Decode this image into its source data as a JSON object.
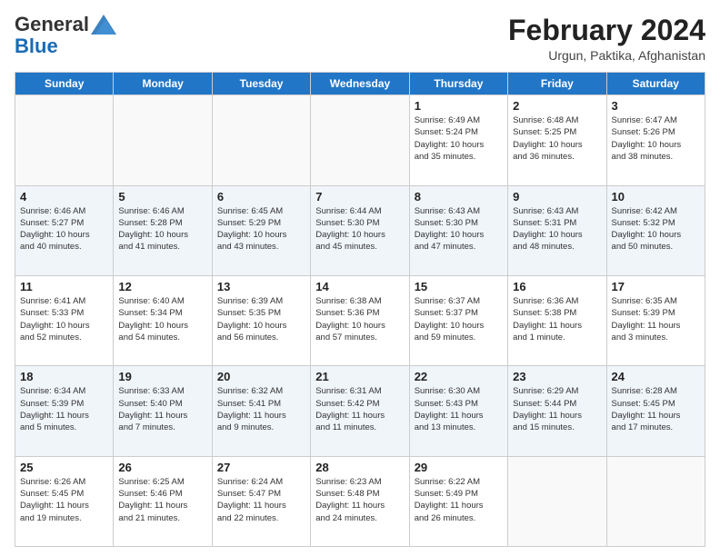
{
  "logo": {
    "general": "General",
    "blue": "Blue"
  },
  "title": "February 2024",
  "location": "Urgun, Paktika, Afghanistan",
  "days_of_week": [
    "Sunday",
    "Monday",
    "Tuesday",
    "Wednesday",
    "Thursday",
    "Friday",
    "Saturday"
  ],
  "weeks": [
    {
      "days": [
        {
          "number": "",
          "info": ""
        },
        {
          "number": "",
          "info": ""
        },
        {
          "number": "",
          "info": ""
        },
        {
          "number": "",
          "info": ""
        },
        {
          "number": "1",
          "info": "Sunrise: 6:49 AM\nSunset: 5:24 PM\nDaylight: 10 hours\nand 35 minutes."
        },
        {
          "number": "2",
          "info": "Sunrise: 6:48 AM\nSunset: 5:25 PM\nDaylight: 10 hours\nand 36 minutes."
        },
        {
          "number": "3",
          "info": "Sunrise: 6:47 AM\nSunset: 5:26 PM\nDaylight: 10 hours\nand 38 minutes."
        }
      ]
    },
    {
      "days": [
        {
          "number": "4",
          "info": "Sunrise: 6:46 AM\nSunset: 5:27 PM\nDaylight: 10 hours\nand 40 minutes."
        },
        {
          "number": "5",
          "info": "Sunrise: 6:46 AM\nSunset: 5:28 PM\nDaylight: 10 hours\nand 41 minutes."
        },
        {
          "number": "6",
          "info": "Sunrise: 6:45 AM\nSunset: 5:29 PM\nDaylight: 10 hours\nand 43 minutes."
        },
        {
          "number": "7",
          "info": "Sunrise: 6:44 AM\nSunset: 5:30 PM\nDaylight: 10 hours\nand 45 minutes."
        },
        {
          "number": "8",
          "info": "Sunrise: 6:43 AM\nSunset: 5:30 PM\nDaylight: 10 hours\nand 47 minutes."
        },
        {
          "number": "9",
          "info": "Sunrise: 6:43 AM\nSunset: 5:31 PM\nDaylight: 10 hours\nand 48 minutes."
        },
        {
          "number": "10",
          "info": "Sunrise: 6:42 AM\nSunset: 5:32 PM\nDaylight: 10 hours\nand 50 minutes."
        }
      ]
    },
    {
      "days": [
        {
          "number": "11",
          "info": "Sunrise: 6:41 AM\nSunset: 5:33 PM\nDaylight: 10 hours\nand 52 minutes."
        },
        {
          "number": "12",
          "info": "Sunrise: 6:40 AM\nSunset: 5:34 PM\nDaylight: 10 hours\nand 54 minutes."
        },
        {
          "number": "13",
          "info": "Sunrise: 6:39 AM\nSunset: 5:35 PM\nDaylight: 10 hours\nand 56 minutes."
        },
        {
          "number": "14",
          "info": "Sunrise: 6:38 AM\nSunset: 5:36 PM\nDaylight: 10 hours\nand 57 minutes."
        },
        {
          "number": "15",
          "info": "Sunrise: 6:37 AM\nSunset: 5:37 PM\nDaylight: 10 hours\nand 59 minutes."
        },
        {
          "number": "16",
          "info": "Sunrise: 6:36 AM\nSunset: 5:38 PM\nDaylight: 11 hours\nand 1 minute."
        },
        {
          "number": "17",
          "info": "Sunrise: 6:35 AM\nSunset: 5:39 PM\nDaylight: 11 hours\nand 3 minutes."
        }
      ]
    },
    {
      "days": [
        {
          "number": "18",
          "info": "Sunrise: 6:34 AM\nSunset: 5:39 PM\nDaylight: 11 hours\nand 5 minutes."
        },
        {
          "number": "19",
          "info": "Sunrise: 6:33 AM\nSunset: 5:40 PM\nDaylight: 11 hours\nand 7 minutes."
        },
        {
          "number": "20",
          "info": "Sunrise: 6:32 AM\nSunset: 5:41 PM\nDaylight: 11 hours\nand 9 minutes."
        },
        {
          "number": "21",
          "info": "Sunrise: 6:31 AM\nSunset: 5:42 PM\nDaylight: 11 hours\nand 11 minutes."
        },
        {
          "number": "22",
          "info": "Sunrise: 6:30 AM\nSunset: 5:43 PM\nDaylight: 11 hours\nand 13 minutes."
        },
        {
          "number": "23",
          "info": "Sunrise: 6:29 AM\nSunset: 5:44 PM\nDaylight: 11 hours\nand 15 minutes."
        },
        {
          "number": "24",
          "info": "Sunrise: 6:28 AM\nSunset: 5:45 PM\nDaylight: 11 hours\nand 17 minutes."
        }
      ]
    },
    {
      "days": [
        {
          "number": "25",
          "info": "Sunrise: 6:26 AM\nSunset: 5:45 PM\nDaylight: 11 hours\nand 19 minutes."
        },
        {
          "number": "26",
          "info": "Sunrise: 6:25 AM\nSunset: 5:46 PM\nDaylight: 11 hours\nand 21 minutes."
        },
        {
          "number": "27",
          "info": "Sunrise: 6:24 AM\nSunset: 5:47 PM\nDaylight: 11 hours\nand 22 minutes."
        },
        {
          "number": "28",
          "info": "Sunrise: 6:23 AM\nSunset: 5:48 PM\nDaylight: 11 hours\nand 24 minutes."
        },
        {
          "number": "29",
          "info": "Sunrise: 6:22 AM\nSunset: 5:49 PM\nDaylight: 11 hours\nand 26 minutes."
        },
        {
          "number": "",
          "info": ""
        },
        {
          "number": "",
          "info": ""
        }
      ]
    }
  ]
}
